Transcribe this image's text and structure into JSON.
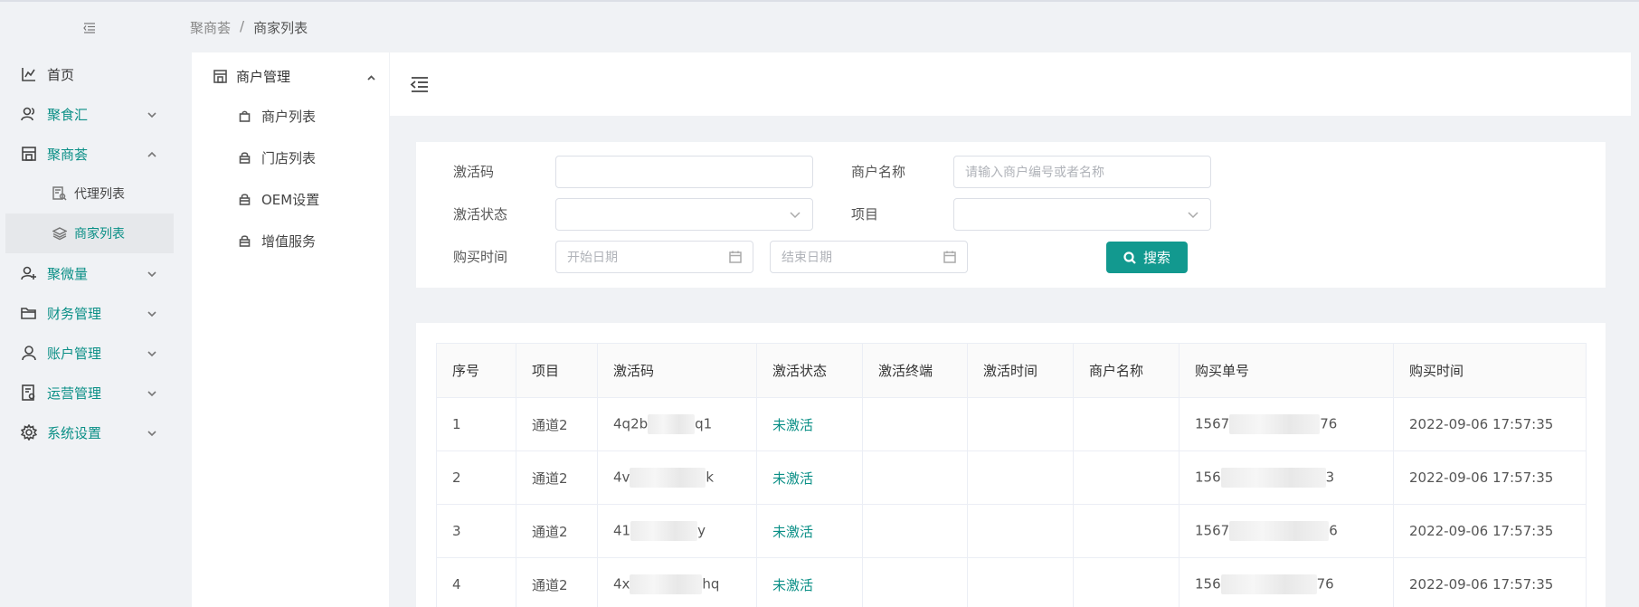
{
  "sidebar": {
    "items": [
      {
        "label": "首页",
        "icon": "chart-icon"
      },
      {
        "label": "聚食汇",
        "icon": "user-group-icon"
      },
      {
        "label": "聚商荟",
        "icon": "store-icon"
      },
      {
        "label": "聚微量",
        "icon": "user-add-icon"
      },
      {
        "label": "财务管理",
        "icon": "folder-icon"
      },
      {
        "label": "账户管理",
        "icon": "user-icon"
      },
      {
        "label": "运营管理",
        "icon": "report-icon"
      },
      {
        "label": "系统设置",
        "icon": "gear-icon"
      }
    ],
    "subitems": [
      {
        "label": "代理列表",
        "icon": "list-search-icon"
      },
      {
        "label": "商家列表",
        "icon": "layers-icon"
      }
    ]
  },
  "breadcrumb": {
    "parent": "聚商荟",
    "separator": "/",
    "current": "商家列表"
  },
  "submenu": {
    "header": "商户管理",
    "items": [
      {
        "label": "商户列表"
      },
      {
        "label": "门店列表"
      },
      {
        "label": "OEM设置"
      },
      {
        "label": "增值服务"
      }
    ]
  },
  "filter": {
    "activation_code_label": "激活码",
    "activation_code_value": "",
    "merchant_name_label": "商户名称",
    "merchant_name_placeholder": "请输入商户编号或者名称",
    "status_label": "激活状态",
    "status_value": "",
    "project_label": "项目",
    "project_value": "",
    "purchase_time_label": "购买时间",
    "start_date_placeholder": "开始日期",
    "end_date_placeholder": "结束日期",
    "search_label": "搜索"
  },
  "table": {
    "columns": [
      "序号",
      "项目",
      "激活码",
      "激活状态",
      "激活终端",
      "激活时间",
      "商户名称",
      "购买单号",
      "购买时间"
    ],
    "rows": [
      {
        "no": "1",
        "project": "通道2",
        "code_start": "4q2b",
        "code_end": "q1",
        "status": "未激活",
        "terminal": "",
        "activated_at": "",
        "merchant": "",
        "order_start": "1567",
        "order_end": "76",
        "time": "2022-09-06 17:57:35"
      },
      {
        "no": "2",
        "project": "通道2",
        "code_start": "4v",
        "code_end": "k",
        "status": "未激活",
        "terminal": "",
        "activated_at": "",
        "merchant": "",
        "order_start": "156",
        "order_end": "3",
        "time": "2022-09-06 17:57:35"
      },
      {
        "no": "3",
        "project": "通道2",
        "code_start": "41",
        "code_end": "y",
        "status": "未激活",
        "terminal": "",
        "activated_at": "",
        "merchant": "",
        "order_start": "1567",
        "order_end": "6",
        "time": "2022-09-06 17:57:35"
      },
      {
        "no": "4",
        "project": "通道2",
        "code_start": "4x",
        "code_end": "hq",
        "status": "未激活",
        "terminal": "",
        "activated_at": "",
        "merchant": "",
        "order_start": "156",
        "order_end": "76",
        "time": "2022-09-06 17:57:35"
      }
    ]
  },
  "colors": {
    "accent": "#12998f",
    "status_text": "#0a8f86",
    "page_bg": "#f0f2f5"
  }
}
